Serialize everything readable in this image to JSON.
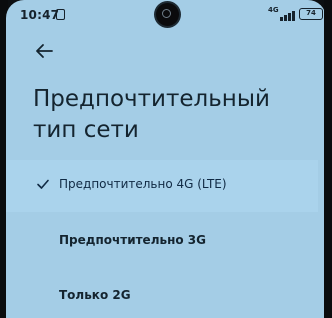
{
  "status_bar": {
    "time": "10:47",
    "network_type": "4G",
    "battery": "74",
    "icons": [
      "notification-icon",
      "camera-cutout",
      "signal-icon",
      "battery-icon"
    ]
  },
  "header": {
    "back_icon": "arrow-left-icon",
    "title": "Предпочтительный тип сети"
  },
  "options": [
    {
      "label": "Предпочтительно 4G (LTE)",
      "selected": true
    },
    {
      "label": "Предпочтительно 3G",
      "selected": false
    },
    {
      "label": "Только 2G",
      "selected": false
    }
  ],
  "colors": {
    "background": "#a4cde6",
    "selected_row": "#aad3ec",
    "text": "#14242f"
  }
}
